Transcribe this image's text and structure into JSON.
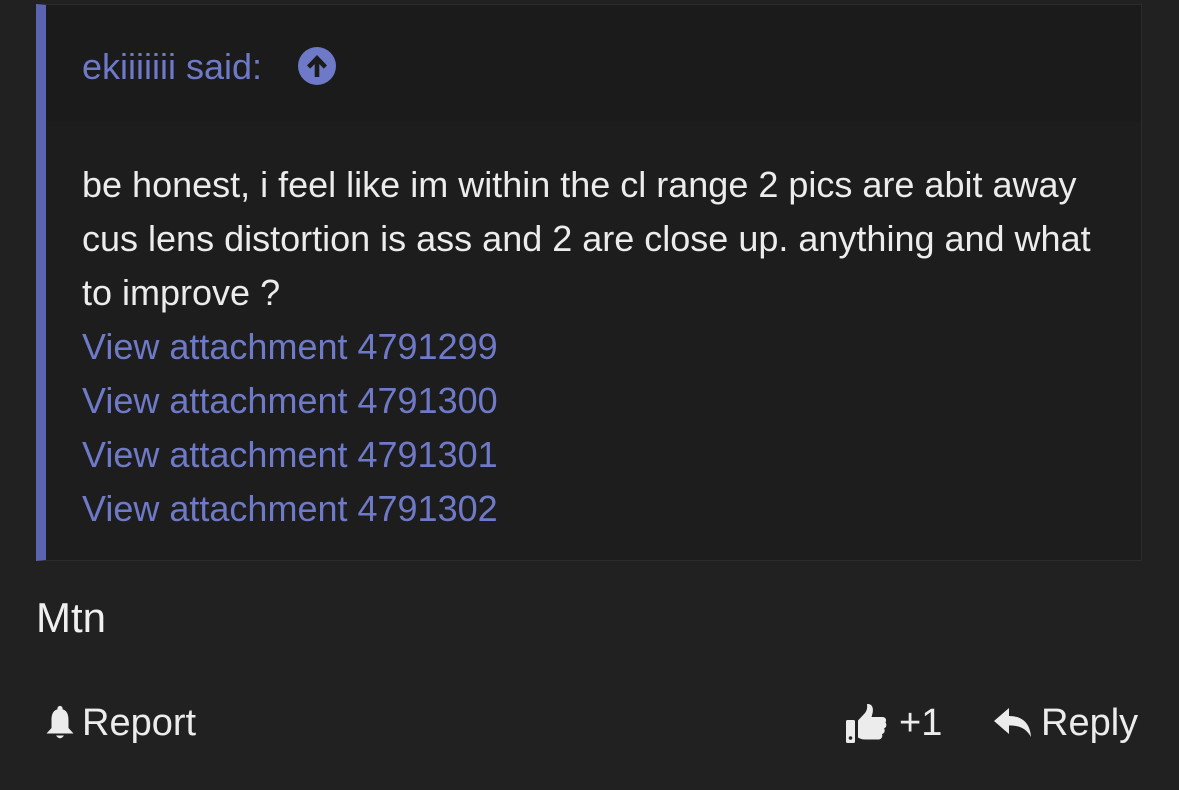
{
  "quote": {
    "author_line": "ekiiiiiii said:",
    "jump_icon": "arrow-up-circle-icon",
    "body_text": "be honest, i feel like im within the cl range 2 pics are abit away cus lens distortion is ass and 2 are close up. anything and what to improve ?",
    "attachments": [
      "View attachment 4791299",
      "View attachment 4791300",
      "View attachment 4791301",
      "View attachment 4791302"
    ]
  },
  "post": {
    "text": "Mtn"
  },
  "actions": {
    "report": {
      "label": "Report",
      "icon": "bell-icon"
    },
    "like": {
      "label": "+1",
      "icon": "thumbs-up-icon"
    },
    "reply": {
      "label": "Reply",
      "icon": "reply-arrow-icon"
    }
  },
  "colors": {
    "background": "#212121",
    "quote_background": "#1d1d1d",
    "quote_accent_bar": "#5b64b0",
    "link": "#6e7ac7",
    "text": "#ececec"
  }
}
